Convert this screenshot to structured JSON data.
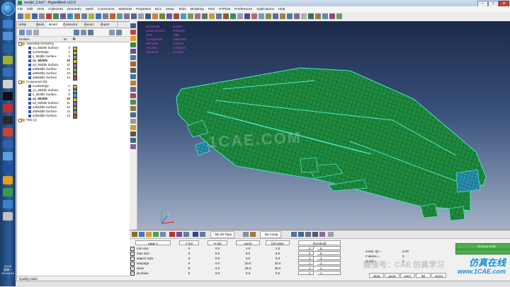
{
  "taskbar": {
    "time": "23:28",
    "day": "星期一",
    "date": "2014/9/15"
  },
  "window": {
    "title": "model_3.hm* - HyperMesh v12.0",
    "min": "–",
    "max": "□",
    "close": "✕"
  },
  "menu": [
    "File",
    "Edit",
    "View",
    "Collectors",
    "Geometry",
    "Mesh",
    "Connectors",
    "Materials",
    "Properties",
    "BCs",
    "Setup",
    "Tools",
    "Morphing",
    "Post",
    "XYPlots",
    "Preferences",
    "Applications",
    "Help"
  ],
  "browser": {
    "tabs": [
      "Utility",
      "Mask",
      "Model",
      "Connector",
      "Export",
      "Import"
    ],
    "active_tab": "Model",
    "columns": {
      "entities": "Entities",
      "id": "ID"
    },
    "tree": [
      {
        "name": "Assembly Hierarchy",
        "id": "",
        "indent": 0,
        "color": ""
      },
      {
        "name": "ou_Middle Surface",
        "id": "3",
        "indent": 1,
        "color": "#d8b020"
      },
      {
        "name": "icon5252pp",
        "id": "1",
        "indent": 1,
        "color": "#d8b020"
      },
      {
        "name": "s_Middle Surface",
        "id": "5",
        "indent": 1,
        "color": "#4aa0d8"
      },
      {
        "name": "a1_Middle",
        "id": "10",
        "indent": 1,
        "color": "#e8c020",
        "selected": true
      },
      {
        "name": "a3_Middle Surface",
        "id": "11",
        "indent": 1,
        "color": "#a060c0"
      },
      {
        "name": "a4Middle Surface",
        "id": "12",
        "indent": 1,
        "color": "#60b060"
      },
      {
        "name": "a5Middle Surface",
        "id": "13",
        "indent": 1,
        "color": "#d08040"
      },
      {
        "name": "a2Middle Surface",
        "id": "14",
        "indent": 1,
        "color": "#c04040"
      },
      {
        "name": "Component (8)",
        "id": "",
        "indent": 0,
        "color": ""
      },
      {
        "name": "icon5252pp",
        "id": "1",
        "indent": 1,
        "color": "#d8b020"
      },
      {
        "name": "ou_Middle Surface",
        "id": "3",
        "indent": 1,
        "color": "#4aa0d8"
      },
      {
        "name": "s_Middle Surface",
        "id": "5",
        "indent": 1,
        "color": "#4aa0d8"
      },
      {
        "name": "a1_Middle",
        "id": "10",
        "indent": 1,
        "color": "#e8c020",
        "selected": true
      },
      {
        "name": "a3_Middle Surface",
        "id": "11",
        "indent": 1,
        "color": "#a060c0"
      },
      {
        "name": "a4Middle Surface",
        "id": "12",
        "indent": 1,
        "color": "#60b060"
      },
      {
        "name": "a5Middle Surface",
        "id": "13",
        "indent": 1,
        "color": "#d08040"
      },
      {
        "name": "a2Middle Surface",
        "id": "14",
        "indent": 1,
        "color": "#c04040"
      },
      {
        "name": "Title (1)",
        "id": "",
        "indent": 0,
        "color": ""
      }
    ],
    "status": "Quality Index"
  },
  "graphics": {
    "stats": [
      [
        "Elements",
        "Nodes"
      ],
      [
        "Load Curves",
        "Property"
      ],
      [
        "Sets",
        "Title"
      ],
      [
        "Component",
        "Materials"
      ],
      [
        "Ref Sets",
        "Solvers"
      ],
      [
        "Vectors",
        "Contacts"
      ],
      [
        "Systems",
        "Groups"
      ]
    ],
    "watermark": "1CAE.COM"
  },
  "bottom": {
    "dropdowns": [
      "By 2D Topo",
      "By Comp"
    ],
    "headers": {
      "page": "page 1",
      "fail": "# fail",
      "pfail": "% fail",
      "worst": "worst",
      "failval": "fail value",
      "threshold": "threshold"
    },
    "rows": [
      {
        "label": "min size",
        "fail": "0",
        "pfail": "0.0",
        "worst": "1.0",
        "failval": "1.0",
        "t1": "2",
        "t2": "5"
      },
      {
        "label": "max size",
        "fail": "0",
        "pfail": "0.0",
        "worst": "5.0",
        "failval": "5.0",
        "t1": "2",
        "t2": "5"
      },
      {
        "label": "aspect ratio",
        "fail": "0",
        "pfail": "0.0",
        "worst": "3.0",
        "failval": "5.0",
        "t1": "1",
        "t2": "1"
      },
      {
        "label": "warpage",
        "fail": "0",
        "pfail": "0.0",
        "worst": "20.0",
        "failval": "20.0",
        "t1": "1",
        "t2": "1"
      },
      {
        "label": "skew",
        "fail": "0",
        "pfail": "0.0",
        "worst": "45.0",
        "failval": "45.0",
        "t1": "1",
        "t2": "1"
      },
      {
        "label": "jacobian",
        "fail": "0",
        "pfail": "0.0",
        "worst": "0.6",
        "failval": "0.6",
        "t1": "1",
        "t2": "1"
      }
    ],
    "comp": [
      {
        "label": "comp. QI =",
        "value": "0.03"
      },
      {
        "label": "# elems =",
        "value": "0"
      },
      {
        "label": "% fail =",
        "value": "0"
      }
    ],
    "cleanup": "cleanup tools",
    "ratings": [
      "ideal",
      "good",
      "warn",
      "fail",
      "worst"
    ],
    "wechat": "微信号：CAE 仿真学习",
    "brand": "仿真在线",
    "brand2": "www.1CAE.com"
  }
}
